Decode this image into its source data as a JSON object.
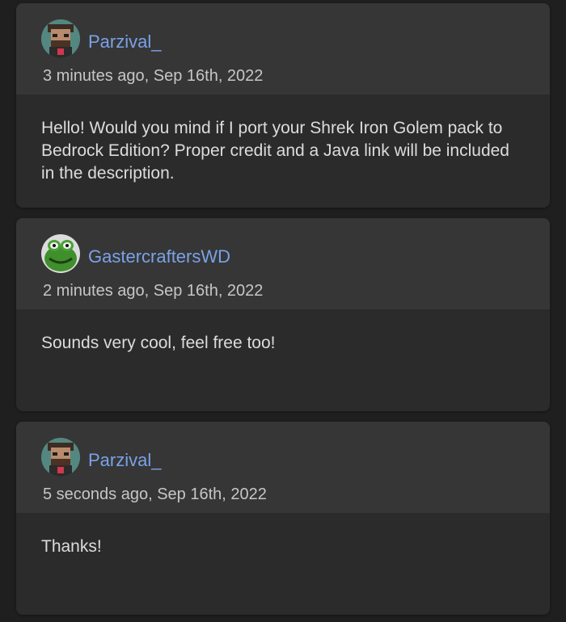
{
  "comments": [
    {
      "username": "Parzival_",
      "timestamp": "3 minutes ago, Sep 16th, 2022",
      "body": "Hello! Would you mind if I port your Shrek Iron Golem pack to Bedrock Edition? Proper credit and a Java link will be included in the description.",
      "avatar": "minecraft-skin-avatar-icon"
    },
    {
      "username": "GastercraftersWD",
      "timestamp": "2 minutes ago, Sep 16th, 2022",
      "body": "Sounds very cool, feel free too!",
      "avatar": "frog-avatar-icon"
    },
    {
      "username": "Parzival_",
      "timestamp": "5 seconds ago, Sep 16th, 2022",
      "body": "Thanks!",
      "avatar": "minecraft-skin-avatar-icon"
    }
  ],
  "colors": {
    "background": "#1f1f1f",
    "card": "#2b2b2b",
    "header": "#363636",
    "username": "#7aa2e8",
    "timestamp": "#c6c6c6",
    "body_text": "#dcdcdc"
  }
}
